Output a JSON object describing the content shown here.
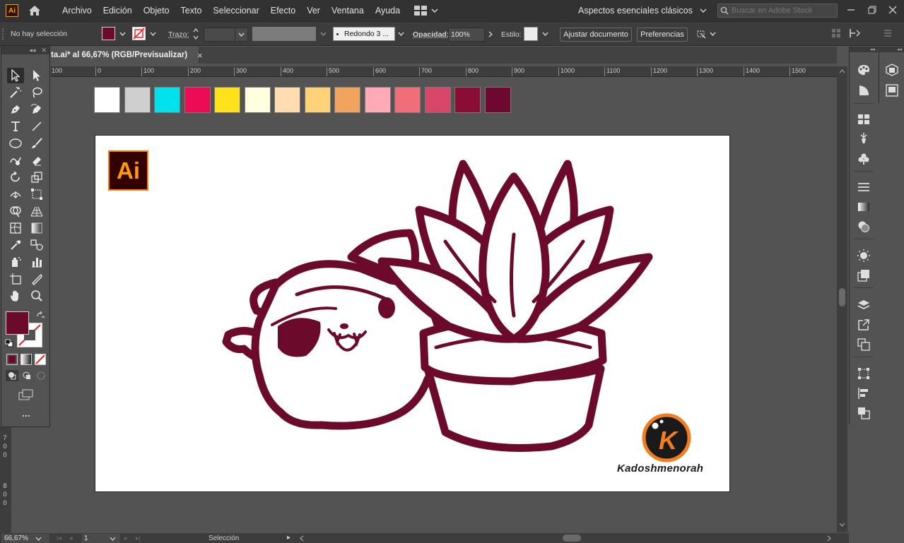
{
  "app": {
    "logo_text": "Ai",
    "menu": [
      "Archivo",
      "Edición",
      "Objeto",
      "Texto",
      "Seleccionar",
      "Efecto",
      "Ver",
      "Ventana",
      "Ayuda"
    ],
    "workspace": "Aspectos esenciales clásicos",
    "stock_placeholder": "Buscar en Adobe Stock"
  },
  "control": {
    "selection_status": "No hay selección",
    "fill_color": "#6b0a2b",
    "stroke_label": "Trazo:",
    "brush_label": "Redondo 3 ...",
    "opacity_label": "Opacidad:",
    "opacity_value": "100%",
    "style_label": "Estilo:",
    "fit_document": "Ajustar documento",
    "preferences": "Preferencias"
  },
  "document": {
    "tab_title": "ta.ai* al 66,67% (RGB/Previsualizar)",
    "close_symbol": "×",
    "ruler_marks": [
      "100",
      "0",
      "100",
      "200",
      "300",
      "400",
      "500",
      "600",
      "700",
      "800",
      "900",
      "1000",
      "1100",
      "1200",
      "1300",
      "1400",
      "1500"
    ],
    "vruler_marks": [
      "7",
      "0",
      "0",
      "8",
      "0",
      "0"
    ]
  },
  "swatches": [
    "#ffffff",
    "#cfcfcf",
    "#00e1ee",
    "#ee0b56",
    "#ffe11c",
    "#ffffe0",
    "#ffddb0",
    "#ffd27a",
    "#f0a45e",
    "#ffaab6",
    "#ef6e7a",
    "#d8476a",
    "#8a0d35",
    "#6e0830"
  ],
  "artwork": {
    "line_color": "#6b0a2b",
    "badge_text": "Ai",
    "brand_letter": "K",
    "brand_name": "Kadoshmenorah",
    "brand_ring_color": "#f37e1f"
  },
  "tools": {
    "fill_color": "#6b0a2b",
    "more_label": "..."
  },
  "status": {
    "zoom": "66,67%",
    "artboard_number": "1",
    "tool_name": "Selección"
  }
}
